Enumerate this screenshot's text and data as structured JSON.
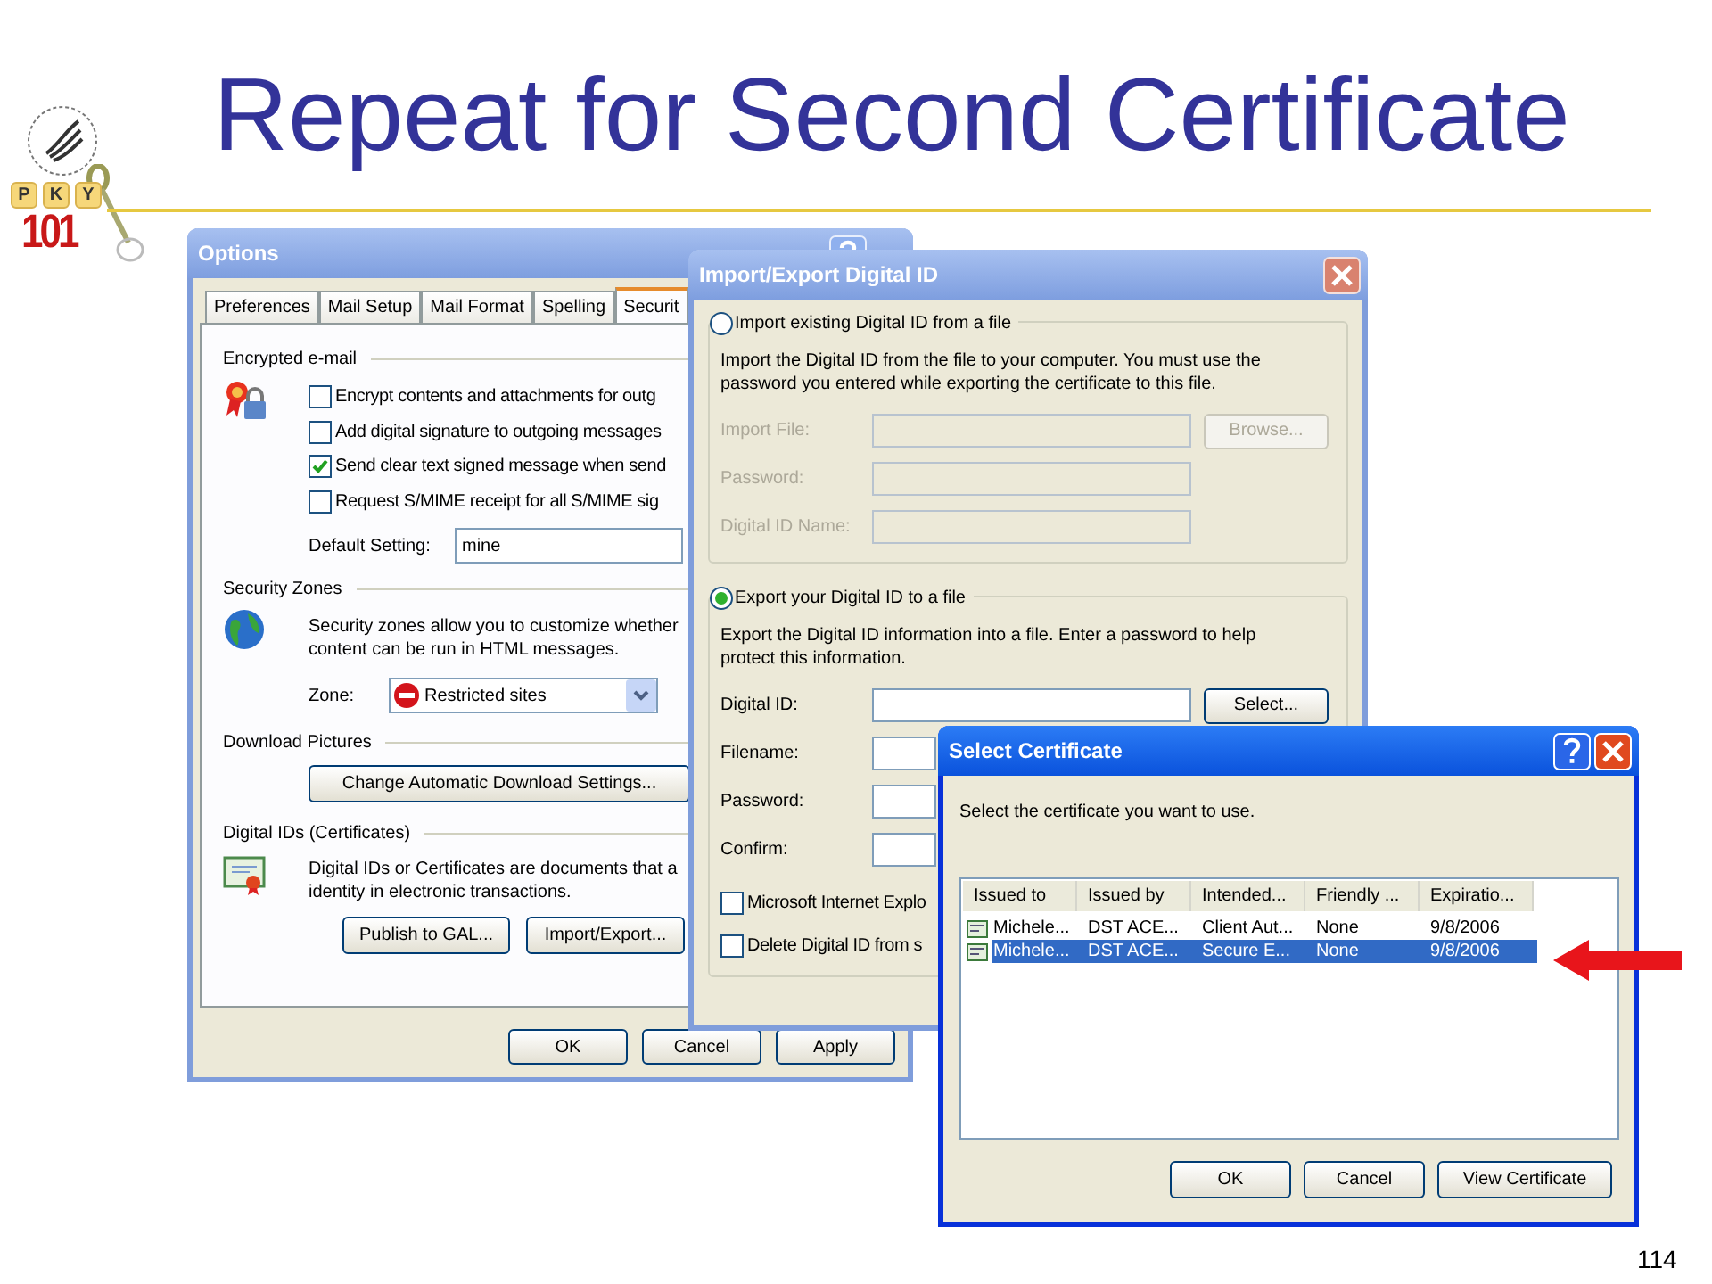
{
  "slide": {
    "title": "Repeat for Second Certificate",
    "page_number": "114",
    "logo": {
      "tiles": [
        "P",
        "K",
        "Y"
      ],
      "number": "101"
    }
  },
  "options_window": {
    "title": "Options",
    "tabs": [
      {
        "label": "Preferences",
        "selected": false
      },
      {
        "label": "Mail Setup",
        "selected": false
      },
      {
        "label": "Mail Format",
        "selected": false
      },
      {
        "label": "Spelling",
        "selected": false
      },
      {
        "label": "Securit",
        "selected": true
      }
    ],
    "encrypted_email": {
      "heading": "Encrypted e-mail",
      "checkboxes": [
        {
          "label": "Encrypt contents and attachments for outg",
          "checked": false
        },
        {
          "label": "Add digital signature to outgoing messages",
          "checked": false
        },
        {
          "label": "Send clear text signed message when send",
          "checked": true
        },
        {
          "label": "Request S/MIME receipt for all S/MIME sig",
          "checked": false
        }
      ],
      "default_setting": {
        "label": "Default Setting:",
        "value": "mine"
      }
    },
    "security_zones": {
      "heading": "Security Zones",
      "description": "Security zones allow you to customize whether\ncontent can be run in HTML messages.",
      "zone": {
        "label": "Zone:",
        "value": "Restricted sites"
      }
    },
    "download_pictures": {
      "heading": "Download Pictures",
      "button": "Change Automatic Download Settings..."
    },
    "digital_ids": {
      "heading": "Digital IDs (Certificates)",
      "description": "Digital IDs or Certificates are documents that a\nidentity in electronic transactions.",
      "buttons": [
        "Publish to GAL...",
        "Import/Export..."
      ]
    },
    "buttons": [
      "OK",
      "Cancel",
      "Apply"
    ]
  },
  "import_export_window": {
    "title": "Import/Export Digital ID",
    "groups": [
      {
        "label": "Import existing Digital ID from a file",
        "selected": false,
        "description": "Import the Digital ID from the file to your computer. You must use the\npassword you entered while exporting the certificate to this file.",
        "fields": [
          {
            "label": "Import File:",
            "disabled": true,
            "button": {
              "label": "Browse...",
              "disabled": true
            }
          },
          {
            "label": "Password:",
            "disabled": true
          },
          {
            "label": "Digital ID Name:",
            "disabled": true
          }
        ]
      },
      {
        "label": "Export your Digital ID to a file",
        "selected": true,
        "description": "Export the Digital ID information into a file. Enter a password to help\nprotect this information.",
        "fields": [
          {
            "label": "Digital ID:",
            "disabled": false,
            "button": {
              "label": "Select...",
              "disabled": false
            }
          },
          {
            "label": "Filename:",
            "disabled": false
          },
          {
            "label": "Password:",
            "disabled": false
          },
          {
            "label": "Confirm:",
            "disabled": false
          }
        ],
        "checkboxes": [
          {
            "label": "Microsoft Internet Explo",
            "checked": false
          },
          {
            "label": "Delete Digital ID from s",
            "checked": false
          }
        ]
      }
    ]
  },
  "select_certificate_window": {
    "title": "Select Certificate",
    "prompt": "Select the certificate you want to use.",
    "columns": [
      "Issued to",
      "Issued by",
      "Intended...",
      "Friendly ...",
      "Expiratio..."
    ],
    "rows": [
      {
        "cells": [
          "Michele...",
          "DST ACE...",
          "Client Aut...",
          "None",
          "9/8/2006"
        ],
        "selected": false
      },
      {
        "cells": [
          "Michele...",
          "DST ACE...",
          "Secure E...",
          "None",
          "9/8/2006"
        ],
        "selected": true
      }
    ],
    "buttons": [
      "OK",
      "Cancel",
      "View Certificate"
    ]
  }
}
